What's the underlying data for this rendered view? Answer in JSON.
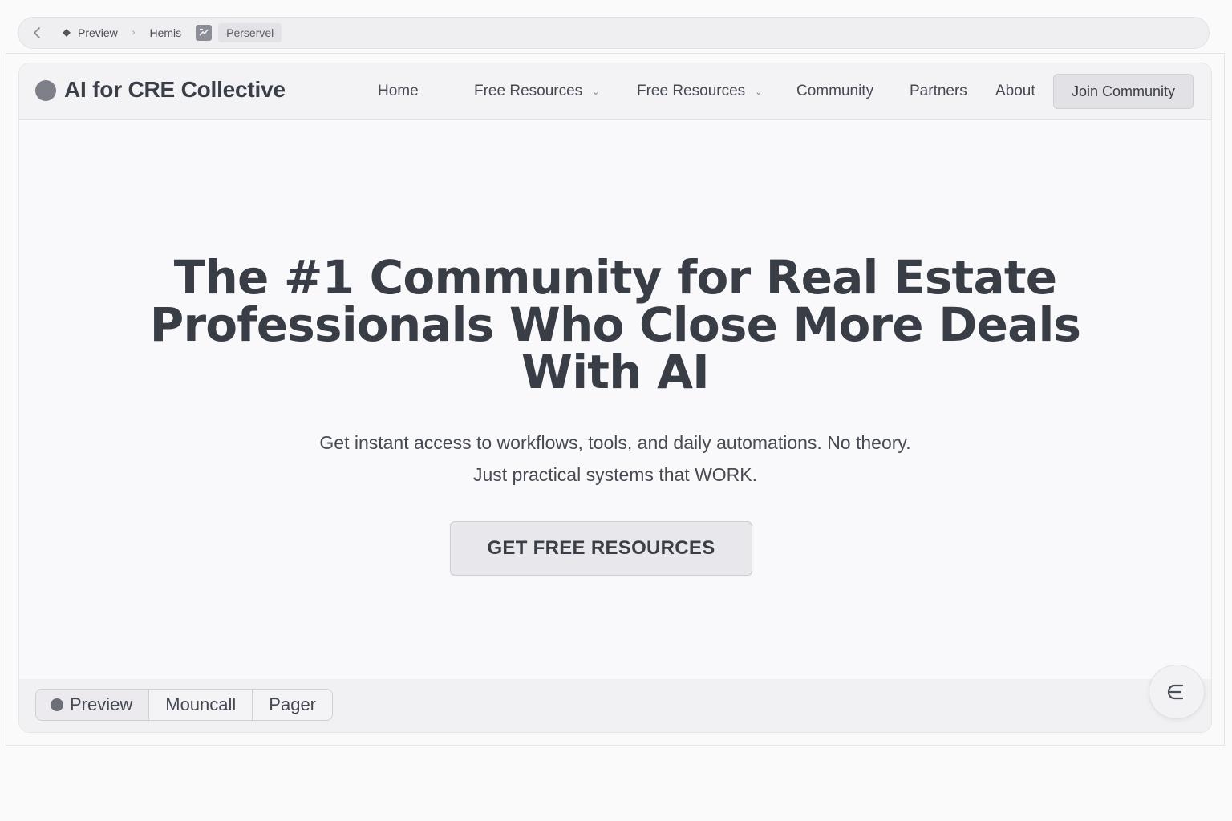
{
  "browser": {
    "breadcrumb": [
      "Preview",
      "Hemis"
    ],
    "active_tab": "Perservel"
  },
  "site": {
    "logo_text": "AI for CRE Collective",
    "nav": {
      "home": "Home",
      "resources_1": "Free Resources",
      "resources_2": "Free Resources",
      "community": "Community",
      "partners": "Partners",
      "about": "About",
      "join": "Join Community"
    }
  },
  "hero": {
    "title_line1": "The #1 Community for Real Estate",
    "title_line2": "Professionals Who Close More Deals",
    "title_line3": "With AI",
    "sub_line1": "Get instant access to workflows, tools, and daily automations. No theory.",
    "sub_line2": "Just practical systems that WORK.",
    "cta": "GET FREE RESOURCES"
  },
  "toolbar": {
    "tabs": [
      "Preview",
      "Mouncall",
      "Pager"
    ]
  },
  "icons": {
    "back": "chevron-left-icon",
    "crumb": "diamond-icon",
    "app": "app-icon",
    "fab": "epsilon-icon"
  }
}
